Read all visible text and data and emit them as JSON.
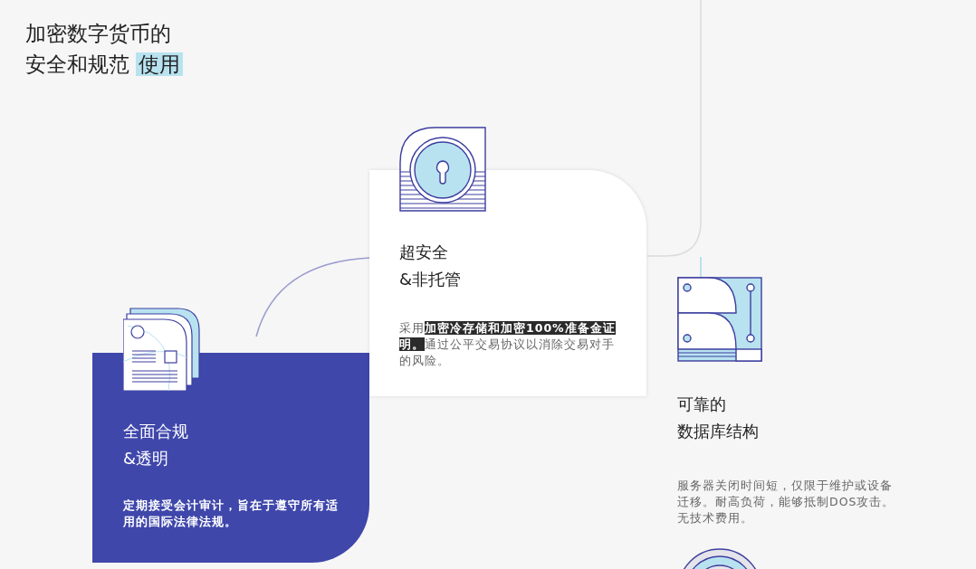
{
  "heading": {
    "line_1": "加密数字货币的",
    "line_2": "安全和规范",
    "highlight": "使用"
  },
  "features": [
    {
      "kind": "compliance",
      "title_1": "全面合规",
      "title_2": "&透明",
      "description": "定期接受会计审计，旨在于遵守所有适用的国际法律法规。"
    },
    {
      "kind": "security",
      "title_1": "超安全",
      "title_2": "&非托管",
      "description": "采用**加密冷存储和加密100%准备金证明。**通过公平交易协议以消除交易对手的风险。"
    },
    {
      "kind": "database",
      "title_1": "可靠的",
      "title_2": "数据库结构",
      "description": "服务器关闭时间短，仅限于维护或设备迁移。耐高负荷，能够抵制DOS攻击。无技术费用。"
    }
  ]
}
